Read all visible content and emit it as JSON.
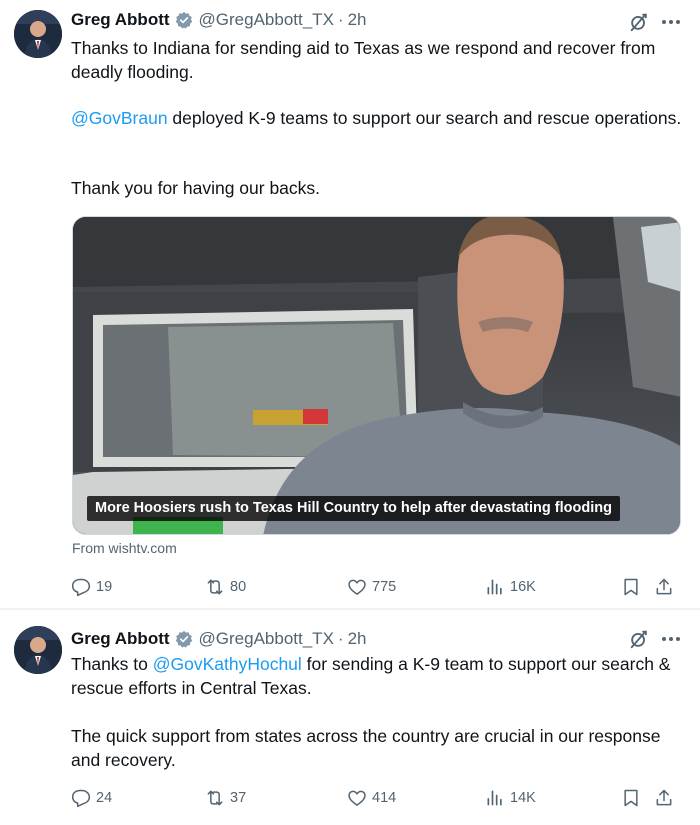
{
  "tweets": [
    {
      "author": {
        "name": "Greg Abbott",
        "handle": "@GregAbbott_TX",
        "time": "2h"
      },
      "text": {
        "p1": "Thanks to Indiana for sending aid to Texas as we respond and recover from deadly flooding.",
        "p2_mention": "@GovBraun",
        "p2_rest": " deployed K-9 teams to support our search and rescue operations.",
        "p3": "Thank you for having our backs."
      },
      "media": {
        "caption": "More Hoosiers rush to Texas Hill Country to help after devastating flooding",
        "source": "From wishtv.com"
      },
      "stats": {
        "replies": "19",
        "reposts": "80",
        "likes": "775",
        "views": "16K"
      }
    },
    {
      "author": {
        "name": "Greg Abbott",
        "handle": "@GregAbbott_TX",
        "time": "2h"
      },
      "text": {
        "p1_prefix": "Thanks to ",
        "p1_mention": "@GovKathyHochul",
        "p1_rest": " for sending a K-9 team to support our search & rescue efforts in Central Texas.",
        "p2": "The quick support from states across the country are crucial in our response and recovery."
      },
      "stats": {
        "replies": "24",
        "reposts": "37",
        "likes": "414",
        "views": "14K"
      }
    }
  ],
  "colors": {
    "link": "#1d9bf0",
    "muted": "#536471",
    "verified": "#829aab"
  },
  "icons": [
    "avatar",
    "verified-badge-icon",
    "grok-icon",
    "more-icon",
    "reply-icon",
    "repost-icon",
    "like-icon",
    "views-icon",
    "bookmark-icon",
    "share-icon"
  ]
}
